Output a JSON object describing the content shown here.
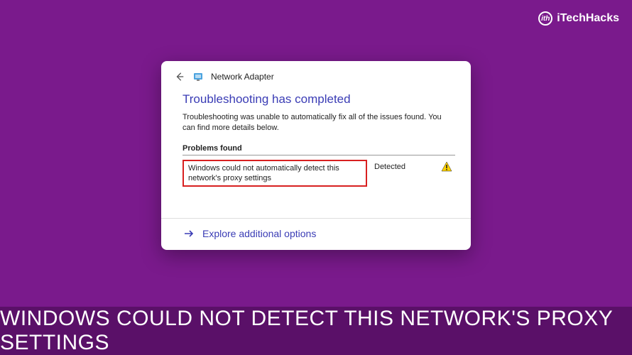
{
  "watermark": {
    "brand": "iTechHacks",
    "icon_text": "ith"
  },
  "dialog": {
    "back_label": "Back",
    "adapter_title": "Network Adapter",
    "heading": "Troubleshooting has completed",
    "sub_text": "Troubleshooting was unable to automatically fix all of the issues found. You can find more details below.",
    "problems_label": "Problems found",
    "problem_text": "Windows could not automatically detect this network's proxy settings",
    "status": "Detected",
    "explore_label": "Explore additional options"
  },
  "banner": {
    "text": "WINDOWS COULD NOT DETECT THIS NETWORK'S PROXY SETTINGS"
  }
}
